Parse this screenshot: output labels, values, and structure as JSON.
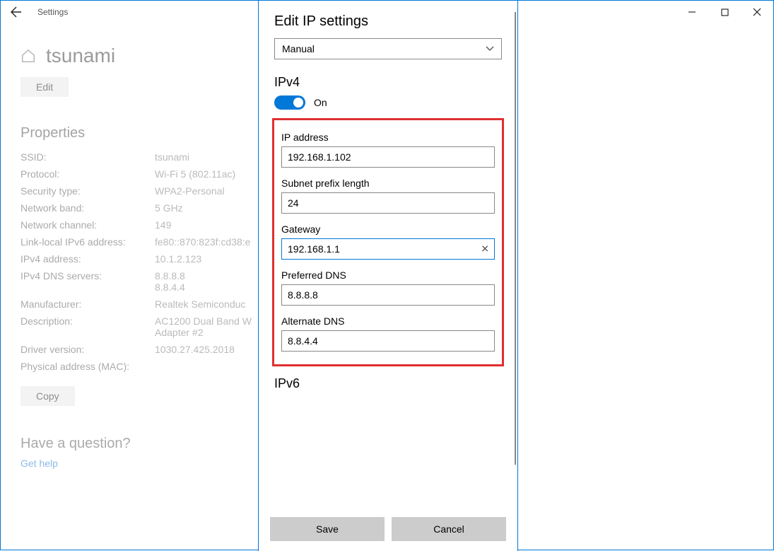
{
  "titlebar": {
    "title": "Settings"
  },
  "page": {
    "network_name": "tsunami",
    "edit_label": "Edit",
    "properties_heading": "Properties",
    "copy_label": "Copy",
    "question": "Have a question?",
    "help_link": "Get help",
    "props": [
      {
        "label": "SSID:",
        "value": "tsunami"
      },
      {
        "label": "Protocol:",
        "value": "Wi-Fi 5 (802.11ac)"
      },
      {
        "label": "Security type:",
        "value": "WPA2-Personal"
      },
      {
        "label": "Network band:",
        "value": "5 GHz"
      },
      {
        "label": "Network channel:",
        "value": "149"
      },
      {
        "label": "Link-local IPv6 address:",
        "value": "fe80::870:823f:cd38:e"
      },
      {
        "label": "IPv4 address:",
        "value": "10.1.2.123"
      },
      {
        "label": "IPv4 DNS servers:",
        "value": "8.8.8.8\n8.8.4.4"
      },
      {
        "label": "Manufacturer:",
        "value": "Realtek Semiconduc"
      },
      {
        "label": "Description:",
        "value": "AC1200  Dual Band W\nAdapter #2"
      },
      {
        "label": "Driver version:",
        "value": "1030.27.425.2018"
      },
      {
        "label": "Physical address (MAC):",
        "value": ""
      }
    ]
  },
  "modal": {
    "title": "Edit IP settings",
    "mode_selected": "Manual",
    "ipv4_heading": "IPv4",
    "toggle_state": "On",
    "fields": {
      "ip_label": "IP address",
      "ip_value": "192.168.1.102",
      "subnet_label": "Subnet prefix length",
      "subnet_value": "24",
      "gateway_label": "Gateway",
      "gateway_value": "192.168.1.1",
      "pref_dns_label": "Preferred DNS",
      "pref_dns_value": "8.8.8.8",
      "alt_dns_label": "Alternate DNS",
      "alt_dns_value": "8.8.4.4"
    },
    "ipv6_heading": "IPv6",
    "save_label": "Save",
    "cancel_label": "Cancel"
  }
}
